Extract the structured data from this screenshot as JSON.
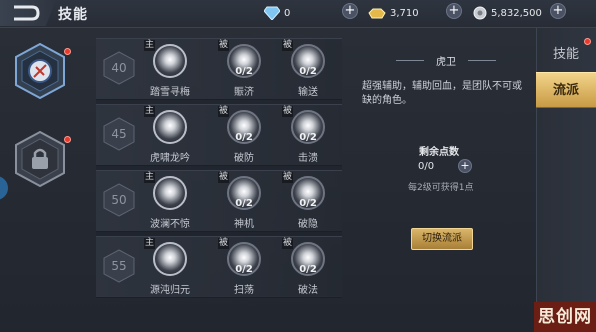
{
  "header": {
    "title": "技能",
    "resources": [
      {
        "icon": "diamond-icon",
        "value": "0"
      },
      {
        "icon": "gold-ingot-icon",
        "value": "3,710"
      },
      {
        "icon": "silver-coin-icon",
        "value": "5,832,500"
      }
    ]
  },
  "skill_rows": [
    {
      "level": "40",
      "skills": [
        {
          "tag": "主",
          "count": "",
          "name": "踏雪寻梅"
        },
        {
          "tag": "被",
          "count": "0/2",
          "name": "賑济"
        },
        {
          "tag": "被",
          "count": "0/2",
          "name": "输送"
        }
      ]
    },
    {
      "level": "45",
      "skills": [
        {
          "tag": "主",
          "count": "",
          "name": "虎啸龙吟"
        },
        {
          "tag": "被",
          "count": "0/2",
          "name": "破防"
        },
        {
          "tag": "被",
          "count": "0/2",
          "name": "击溃"
        }
      ]
    },
    {
      "level": "50",
      "skills": [
        {
          "tag": "主",
          "count": "",
          "name": "波澜不惊"
        },
        {
          "tag": "被",
          "count": "0/2",
          "name": "神机"
        },
        {
          "tag": "被",
          "count": "0/2",
          "name": "破隐"
        }
      ]
    },
    {
      "level": "55",
      "skills": [
        {
          "tag": "主",
          "count": "",
          "name": "源沌归元"
        },
        {
          "tag": "被",
          "count": "0/2",
          "name": "扫荡"
        },
        {
          "tag": "被",
          "count": "0/2",
          "name": "破法"
        }
      ]
    }
  ],
  "info": {
    "title": "虎卫",
    "description": "超强辅助，辅助回血，是团队不可或缺的角色。",
    "points_label": "剩余点数",
    "points_value": "0/0",
    "points_hint": "每2级可获得1点",
    "switch_button": "切换流派"
  },
  "tabs": {
    "skills": "技能",
    "school": "流派"
  },
  "watermark": "思创网",
  "colors": {
    "accent_gold": "#d9b56a",
    "notify_red": "#e83b2e",
    "background": "#22262e"
  }
}
